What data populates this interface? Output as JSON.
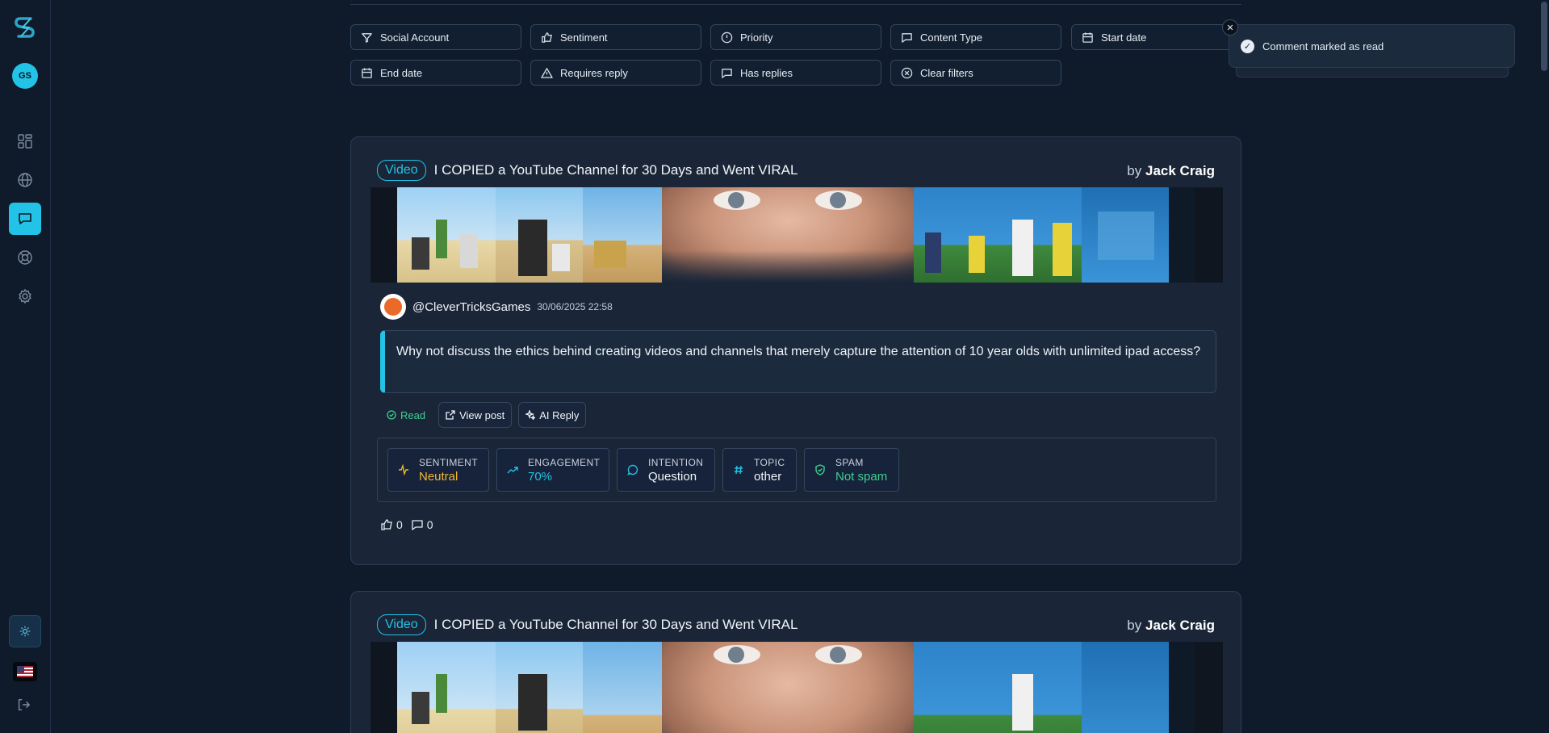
{
  "user": {
    "initials": "GS"
  },
  "nav": [
    {
      "name": "dashboard-icon"
    },
    {
      "name": "globe-icon"
    },
    {
      "name": "comments-icon",
      "active": true
    },
    {
      "name": "support-icon"
    },
    {
      "name": "settings-icon"
    }
  ],
  "filters": {
    "social_account": "Social Account",
    "sentiment": "Sentiment",
    "priority": "Priority",
    "content_type": "Content Type",
    "start_date": "Start date",
    "end_date": "End date",
    "requires_reply": "Requires reply",
    "has_replies": "Has replies",
    "clear_filters": "Clear filters"
  },
  "toast": {
    "message": "Comment marked as read"
  },
  "posts": [
    {
      "badge": "Video",
      "title": "I COPIED a YouTube Channel for 30 Days and Went VIRAL",
      "by": "by",
      "author": "Jack Craig",
      "comment": {
        "handle": "@CleverTricksGames",
        "date": "30/06/2025 22:58",
        "text": "Why not discuss the ethics behind creating videos and channels that merely capture the attention of 10 year olds with unlimited ipad access?"
      },
      "actions": {
        "read": "Read",
        "view_post": "View post",
        "ai_reply": "AI Reply"
      },
      "metrics": {
        "sentiment_label": "SENTIMENT",
        "sentiment_value": "Neutral",
        "engagement_label": "ENGAGEMENT",
        "engagement_value": "70%",
        "intention_label": "INTENTION",
        "intention_value": "Question",
        "topic_label": "TOPIC",
        "topic_value": "other",
        "spam_label": "SPAM",
        "spam_value": "Not spam"
      },
      "likes": "0",
      "replies": "0"
    },
    {
      "badge": "Video",
      "title": "I COPIED a YouTube Channel for 30 Days and Went VIRAL",
      "by": "by",
      "author": "Jack Craig"
    }
  ],
  "colors": {
    "accent": "#22c3e6",
    "neutral": "#f5b731",
    "positive": "#3ecf8e",
    "background": "#0f1b2a",
    "card": "#1a2638"
  }
}
